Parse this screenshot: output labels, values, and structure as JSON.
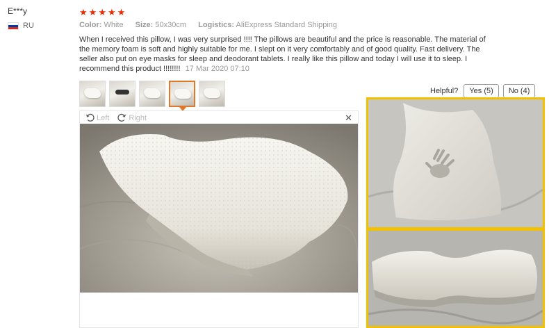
{
  "reviewer": {
    "name": "E***y",
    "country_code": "RU",
    "flag_colors": [
      "#ffffff",
      "#0039a6",
      "#d52b1e"
    ]
  },
  "rating": {
    "stars": 5,
    "max": 5,
    "color": "#e62e04"
  },
  "meta": {
    "color_label": "Color:",
    "color_value": "White",
    "size_label": "Size:",
    "size_value": "50x30cm",
    "logistics_label": "Logistics:",
    "logistics_value": "AliExpress Standard Shipping"
  },
  "review": {
    "text": "When I received this pillow, I was very surprised !!!! The pillows are beautiful and the price is reasonable. The material of the memory foam is soft and highly suitable for me. I slept on it very comfortably and of good quality. Fast delivery. The seller also put on eye masks for sleep and deodorant tablets. I really like this pillow and today I will use it to sleep. I recommend this product !!!!!!!!",
    "date": "17 Mar 2020 07:10"
  },
  "thumbnails": {
    "count": 5,
    "active_index": 3,
    "active_color": "#e07a2a"
  },
  "helpful": {
    "label": "Helpful?",
    "yes_label": "Yes (5)",
    "no_label": "No (4)"
  },
  "viewer": {
    "rotate_left_label": "Left",
    "rotate_right_label": "Right",
    "close_icon": "close-icon"
  },
  "highlight_color": "#f2c200"
}
